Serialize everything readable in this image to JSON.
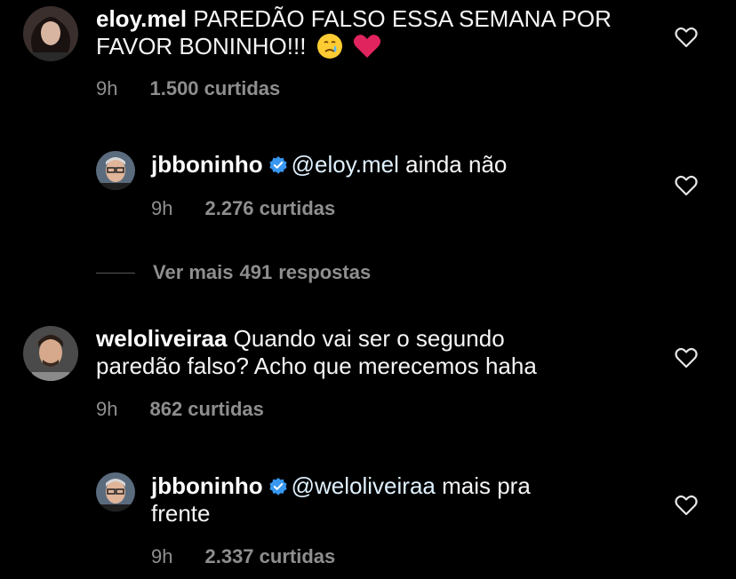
{
  "colors": {
    "background": "#000000",
    "text": "#f5f5f5",
    "meta": "#8e8e8e",
    "mention": "#e0f1ff",
    "verified": "#3897f0",
    "heart_emoji": "#e0245e"
  },
  "comments": [
    {
      "username": "eloy.mel",
      "text": "PAREDÃO FALSO ESSA SEMANA POR FAVOR BONINHO!!!",
      "emojis": [
        "crying-face-emoji",
        "red-heart-emoji"
      ],
      "time": "9h",
      "likes": "1.500 curtidas",
      "avatar_icon": "woman-avatar"
    },
    {
      "username": "jbboninho",
      "verified": true,
      "mention": "@eloy.mel",
      "text": "ainda não",
      "time": "9h",
      "likes": "2.276 curtidas",
      "avatar_icon": "boninho-avatar"
    },
    {
      "username": "weloliveiraa",
      "text_line1": "Quando vai ser o segundo",
      "text_line2": "paredão falso? Acho que merecemos haha",
      "time": "9h",
      "likes": "862 curtidas",
      "avatar_icon": "man-avatar"
    },
    {
      "username": "jbboninho",
      "verified": true,
      "mention": "@weloliveiraa",
      "text_line1": "mais pra",
      "text_line2": "frente",
      "time": "9h",
      "likes": "2.337 curtidas",
      "avatar_icon": "boninho-avatar"
    }
  ],
  "view_more": {
    "label": "Ver mais",
    "count": "491",
    "suffix": "respostas"
  }
}
